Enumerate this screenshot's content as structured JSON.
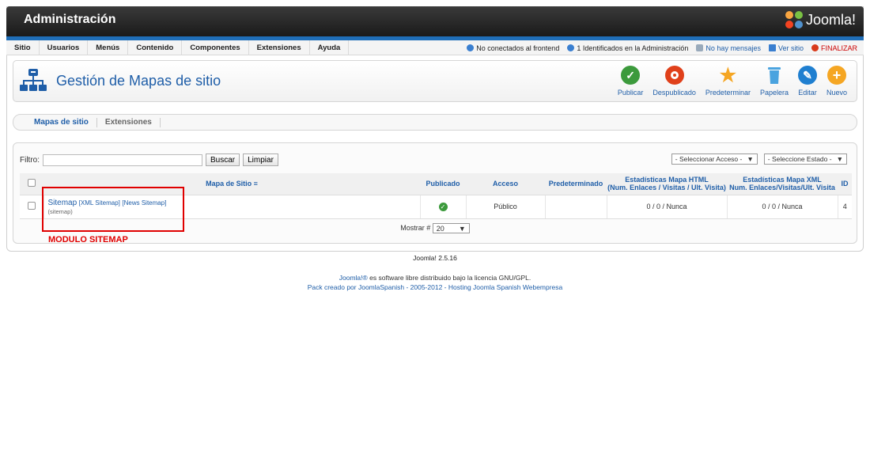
{
  "header": {
    "title": "Administración",
    "logo_text": "Joomla!"
  },
  "menu": [
    "Sitio",
    "Usuarios",
    "Menús",
    "Contenido",
    "Componentes",
    "Extensiones",
    "Ayuda"
  ],
  "status": {
    "frontend": "No conectados al frontend",
    "admin": "1 Identificados en la Administración",
    "messages": "No hay mensajes",
    "view_site": "Ver sitio",
    "logout": "FINALIZAR"
  },
  "page": {
    "title": "Gestión de Mapas de sitio"
  },
  "toolbar": [
    {
      "label": "Publicar",
      "icon": "check-icon",
      "color": "#3c9a3c"
    },
    {
      "label": "Despublicado",
      "icon": "unpublish-icon",
      "color": "#e0401a"
    },
    {
      "label": "Predeterminar",
      "icon": "star-icon",
      "color": "#f5a623"
    },
    {
      "label": "Papelera",
      "icon": "trash-icon",
      "color": "#4aa3df"
    },
    {
      "label": "Editar",
      "icon": "edit-icon",
      "color": "#1f7fd0"
    },
    {
      "label": "Nuevo",
      "icon": "new-icon",
      "color": "#f5a623"
    }
  ],
  "tabs": [
    "Mapas de sitio",
    "Extensiones"
  ],
  "filter": {
    "label": "Filtro:",
    "value": "",
    "search_btn": "Buscar",
    "clear_btn": "Limpiar"
  },
  "selects": {
    "access": "- Seleccionar Acceso -",
    "state": "- Seleccione Estado -"
  },
  "table": {
    "headers": {
      "name": "Mapa de Sitio",
      "published": "Publicado",
      "access": "Acceso",
      "default": "Predeterminado",
      "html_stats_1": "Estadísticas Mapa HTML",
      "html_stats_2": "(Num. Enlaces / Visitas / Ult. Visita)",
      "xml_stats_1": "Estadísticas Mapa XML",
      "xml_stats_2": "Num. Enlaces/Visitas/Ult. Visita",
      "id": "ID"
    },
    "row": {
      "name": "Sitemap",
      "xml_link": "[XML Sitemap]",
      "news_link": "[News Sitemap]",
      "alias": "(sitemap)",
      "access": "Público",
      "html_stats": "0 / 0 / Nunca",
      "xml_stats": "0 / 0 / Nunca",
      "id": "4"
    }
  },
  "pagination": {
    "label": "Mostrar #",
    "value": "20"
  },
  "annotation": "MODULO SITEMAP",
  "version": "Joomla! 2.5.16",
  "footer": {
    "line1_link": "Joomla!®",
    "line1_text": " es software libre distribuido bajo la licencia GNU/GPL.",
    "line2": "Pack creado por JoomlaSpanish - 2005-2012 - Hosting Joomla Spanish Webempresa"
  }
}
